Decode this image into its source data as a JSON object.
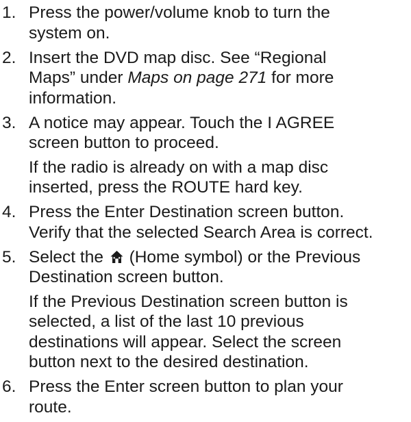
{
  "steps": [
    {
      "number": "1.",
      "lines": [
        "Press the power/volume knob to turn the",
        "system on."
      ]
    },
    {
      "number": "2.",
      "line1": "Insert the DVD map disc. See “Regional",
      "line2_pre": "Maps” under ",
      "line2_ref": "Maps on page 271",
      "line2_post": " for more",
      "line3": "information."
    },
    {
      "number": "3.",
      "lines": [
        "A notice may appear. Touch the I AGREE",
        "screen button to proceed."
      ],
      "note": [
        "If the radio is already on with a map disc",
        "inserted, press the ROUTE hard key."
      ]
    },
    {
      "number": "4.",
      "lines": [
        "Press the Enter Destination screen button.",
        "Verify that the selected Search Area is correct."
      ]
    },
    {
      "number": "5.",
      "line1_pre": "Select the",
      "icon": "home-icon",
      "line1_post": "(Home symbol) or the Previous",
      "line2": "Destination screen button.",
      "note": [
        "If the Previous Destination screen button is",
        "selected, a list of the last 10 previous",
        "destinations will appear. Select the screen",
        "button next to the desired destination."
      ]
    },
    {
      "number": "6.",
      "lines": [
        "Press the Enter screen button to plan your",
        "route."
      ]
    }
  ]
}
